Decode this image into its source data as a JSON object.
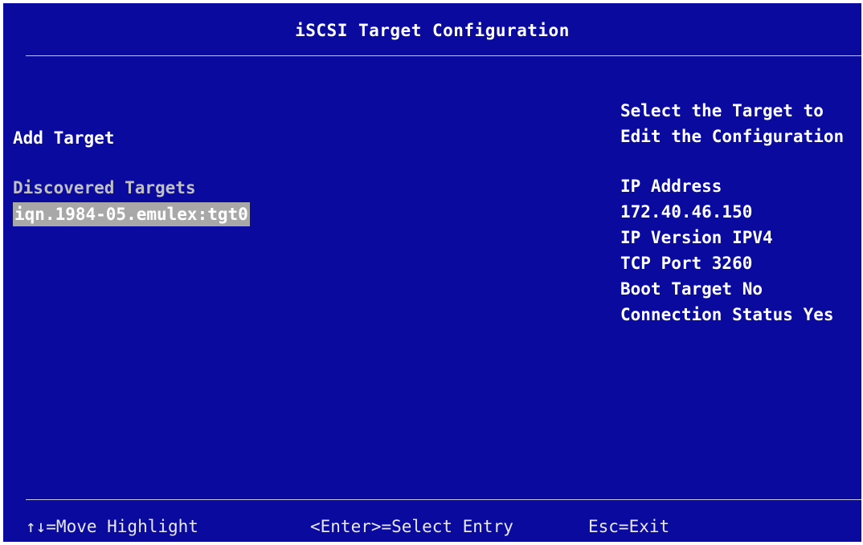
{
  "title": "iSCSI Target Configuration",
  "menu": {
    "add_target": "Add Target",
    "discovered_label": "Discovered Targets",
    "targets": [
      "iqn.1984-05.emulex:tgt0"
    ]
  },
  "help": {
    "line1": "Select the Target to",
    "line2": "Edit the Configuration",
    "details": [
      "IP Address",
      "172.40.46.150",
      "IP Version IPV4",
      "TCP Port 3260",
      "Boot Target No",
      "Connection Status Yes"
    ]
  },
  "footer": {
    "move": "↑↓=Move Highlight",
    "select": "<Enter>=Select Entry",
    "exit": "Esc=Exit"
  },
  "colors": {
    "background": "#0a0a9e",
    "highlight": "#a8a8a8",
    "disabled_text": "#c0c0c0",
    "text": "#ffffff"
  }
}
